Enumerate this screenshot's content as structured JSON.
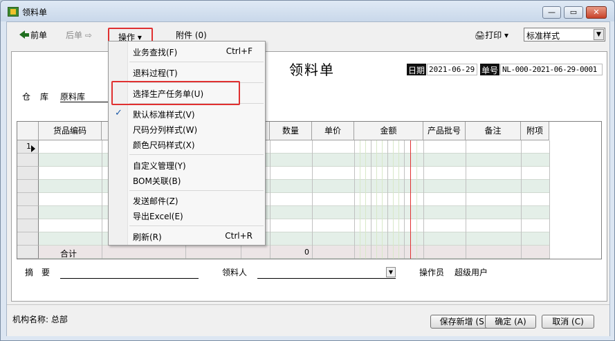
{
  "window": {
    "title": "领料单",
    "min_label": "—",
    "max_label": "▭",
    "close_label": "✕"
  },
  "toolbar": {
    "prev_label": "前单",
    "next_label": "后单",
    "next_arrow": "⇨",
    "ops_label": "操作 ▾",
    "attach_label": "附件 (0)",
    "print_label": "🖨打印 ▾",
    "style_select_value": "标准样式",
    "dropdown_arrow": "▼"
  },
  "form": {
    "title": "领料单",
    "date_label": "日期",
    "date_value": "2021-06-29",
    "no_label": "单号",
    "no_value": "NL-000-2021-06-29-0001",
    "warehouse_label": "仓库",
    "warehouse_value": "原料库"
  },
  "grid": {
    "columns": [
      "货品编码",
      "",
      "",
      "",
      "数量",
      "单价",
      "金额",
      "产品批号",
      "备注",
      "附项"
    ],
    "first_row_number": "1",
    "total_label": "合计",
    "total_qty": "0"
  },
  "footer_fields": {
    "summary_label": "摘要",
    "receiver_label": "领料人",
    "operator_label": "操作员",
    "operator_value": "超级用户",
    "dropdown_arrow": "▼"
  },
  "statusbar": {
    "org_label": "机构名称: 总部",
    "save_new_label": "保存新增 (S)",
    "ok_label": "确定 (A)",
    "cancel_label": "取消 (C)"
  },
  "menu": {
    "items": [
      {
        "label": "业务查找(F)",
        "shortcut": "Ctrl+F"
      },
      {
        "label": "退料过程(T)",
        "shortcut": ""
      },
      {
        "label": "选择生产任务单(U)",
        "shortcut": ""
      },
      {
        "label": "默认标准样式(V)",
        "shortcut": "",
        "checked": true
      },
      {
        "label": "尺码分列样式(W)",
        "shortcut": ""
      },
      {
        "label": "颜色尺码样式(X)",
        "shortcut": ""
      },
      {
        "label": "自定义管理(Y)",
        "shortcut": ""
      },
      {
        "label": "BOM关联(B)",
        "shortcut": ""
      },
      {
        "label": "发送邮件(Z)",
        "shortcut": ""
      },
      {
        "label": "导出Excel(E)",
        "shortcut": ""
      },
      {
        "label": "刷新(R)",
        "shortcut": "Ctrl+R"
      }
    ],
    "check_mark": "✓"
  }
}
